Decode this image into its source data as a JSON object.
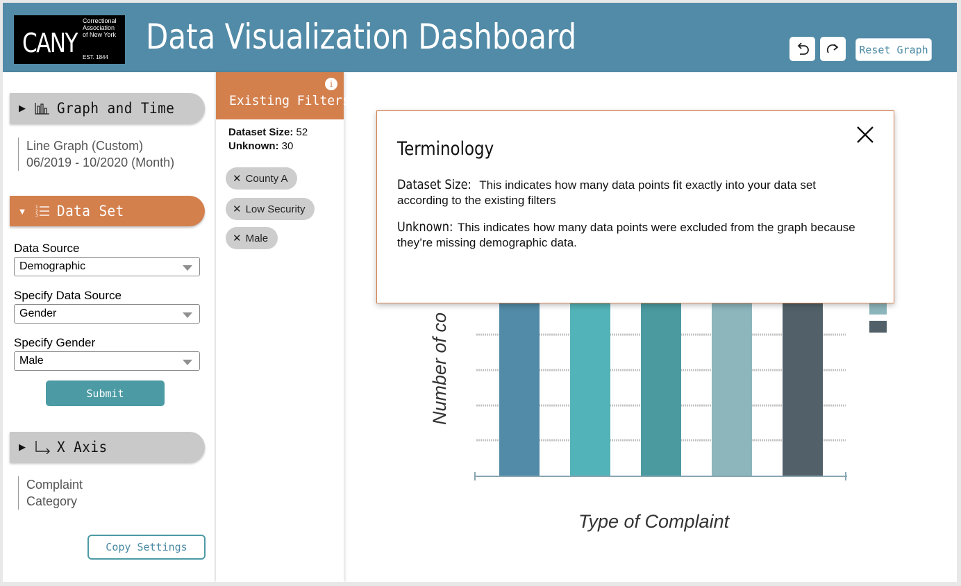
{
  "header": {
    "logo_main": "CANY",
    "logo_small": [
      "Correctional",
      "Association",
      "of New York"
    ],
    "logo_est": "EST. 1844",
    "title": "Data Visualization Dashboard",
    "reset_label": "Reset Graph"
  },
  "sidebar": {
    "graph_section": {
      "label": "Graph and Time",
      "summary_line1": "Line Graph (Custom)",
      "summary_line2": "06/2019 - 10/2020 (Month)"
    },
    "dataset_section": {
      "label": "Data Set",
      "data_source_label": "Data Source",
      "data_source_value": "Demographic",
      "specify_source_label": "Specify Data Source",
      "specify_source_value": "Gender",
      "specify_gender_label": "Specify Gender",
      "specify_gender_value": "Male",
      "submit_label": "Submit"
    },
    "xaxis_section": {
      "label": "X Axis",
      "summary_line1": "Complaint",
      "summary_line2": "Category"
    },
    "copy_label": "Copy Settings"
  },
  "filters": {
    "title": "Existing Filters",
    "info_glyph": "i",
    "dataset_size_label": "Dataset Size:",
    "dataset_size_value": "52",
    "unknown_label": "Unknown:",
    "unknown_value": "30",
    "chips": [
      "County A",
      "Low Security",
      "Male"
    ]
  },
  "chart_data": {
    "type": "bar",
    "ylabel": "Number of co",
    "xlabel": "Type of Complaint",
    "colors": [
      "#528ba7",
      "#52b3b8",
      "#4b9aa0",
      "#8cb5bc",
      "#526169"
    ],
    "legend_colors": [
      "#8cb5bc",
      "#526169"
    ],
    "grid": true
  },
  "modal": {
    "title": "Terminology",
    "term1_key": "Dataset Size:",
    "term1_text": "This indicates how many data points fit exactly into your data set according to the existing filters",
    "term2_key": "Unknown:",
    "term2_text": "This indicates how many data points were excluded from the graph because they’re missing demographic data."
  }
}
